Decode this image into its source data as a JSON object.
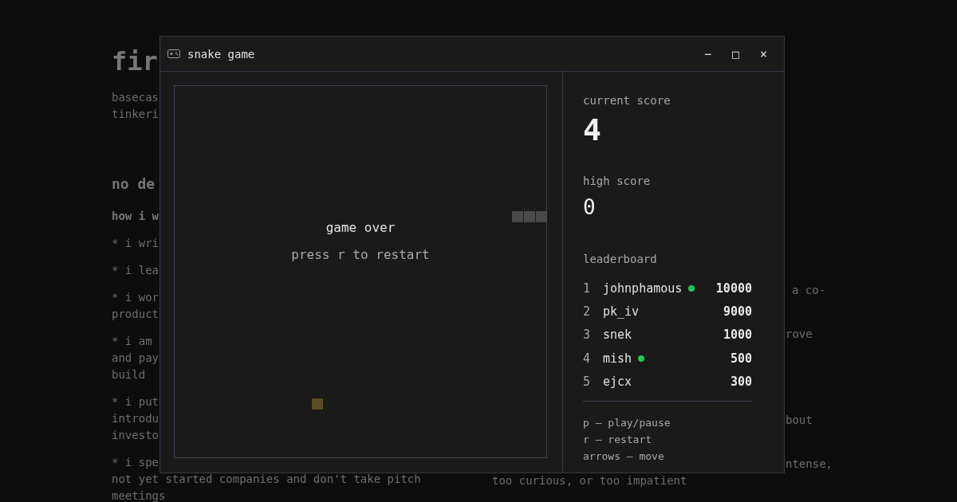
{
  "background": {
    "left": [
      {
        "kind": "title",
        "text": "fir"
      },
      {
        "kind": "intro",
        "text": "basecas"
      },
      {
        "kind": "cont",
        "text": "tinkeri"
      },
      {
        "kind": "heading",
        "text": "no de"
      },
      {
        "kind": "subheading",
        "text": "how i w"
      },
      {
        "kind": "para",
        "text": "* i wri"
      },
      {
        "kind": "para",
        "text": "* i lea"
      },
      {
        "kind": "para",
        "text": "* i wor"
      },
      {
        "kind": "cont",
        "text": "product"
      },
      {
        "kind": "para",
        "text": "* i am"
      },
      {
        "kind": "cont",
        "text": "and pay"
      },
      {
        "kind": "cont",
        "text": "build"
      },
      {
        "kind": "para",
        "text": "* i put"
      },
      {
        "kind": "cont",
        "text": "introdu"
      },
      {
        "kind": "cont",
        "text": "investo"
      },
      {
        "kind": "para",
        "text": "* i spe"
      },
      {
        "kind": "cont",
        "text": "not yet started companies and don't take pitch"
      },
      {
        "kind": "cont",
        "text": "meetings"
      }
    ],
    "right": [
      {
        "kind": "first",
        "text": "a co-"
      },
      {
        "kind": "para-after-line",
        "text": "rove"
      },
      {
        "kind": "para-after-lines",
        "text": "bout"
      },
      {
        "kind": "para-after-line",
        "text": "ntense,"
      },
      {
        "kind": "line",
        "text": "too curious, or too impatient"
      }
    ]
  },
  "window": {
    "title": "snake game",
    "controls": [
      "−",
      "□",
      "×"
    ]
  },
  "game": {
    "message": "game over",
    "hint": "press r to restart"
  },
  "panel": {
    "current_label": "current score",
    "current": "4",
    "high_label": "high score",
    "high": "0",
    "leaderboard_label": "leaderboard",
    "leaderboard": [
      {
        "rank": "1",
        "name": "johnphamous",
        "online": true,
        "score": "10000"
      },
      {
        "rank": "2",
        "name": "pk_iv",
        "online": false,
        "score": "9000"
      },
      {
        "rank": "3",
        "name": "snek",
        "online": false,
        "score": "1000"
      },
      {
        "rank": "4",
        "name": "mish",
        "online": true,
        "score": "500"
      },
      {
        "rank": "5",
        "name": "ejcx",
        "online": false,
        "score": "300"
      }
    ],
    "keys": [
      "p – play/pause",
      "r – restart",
      "arrows – move"
    ]
  }
}
